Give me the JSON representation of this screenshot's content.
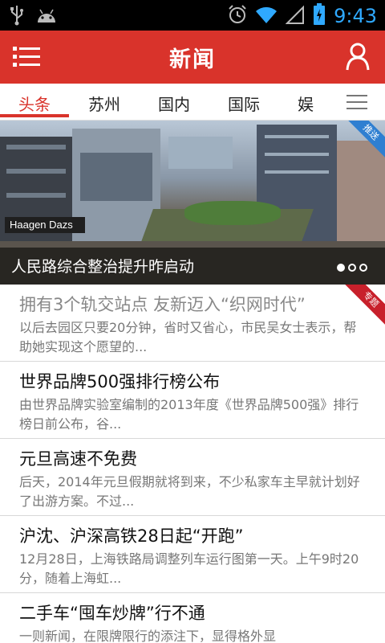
{
  "status_bar": {
    "time": "9:43",
    "icons": [
      "usb-icon",
      "android-icon",
      "alarm-icon",
      "wifi-icon",
      "signal-icon",
      "battery-icon"
    ]
  },
  "header": {
    "title": "新闻",
    "menu_icon": "menu-icon",
    "user_icon": "user-icon",
    "color": "#d9332b"
  },
  "tabs": [
    {
      "label": "头条",
      "active": true
    },
    {
      "label": "苏州"
    },
    {
      "label": "国内"
    },
    {
      "label": "国际"
    },
    {
      "label": "娱"
    }
  ],
  "banner": {
    "caption": "人民路综合整治提升昨启动",
    "tag": "推送",
    "sign_text": "Haagen Dazs"
  },
  "news": [
    {
      "title": "拥有3个轨交站点 友新迈入“织网时代”",
      "desc": "以后去园区只要20分钟，省时又省心，市民吴女士表示，帮助她实现这个愿望的...",
      "tag": "专题",
      "read": true
    },
    {
      "title": "世界品牌500强排行榜公布",
      "desc": "由世界品牌实验室编制的2013年度《世界品牌500强》排行榜日前公布，谷..."
    },
    {
      "title": "元旦高速不免费",
      "desc": "后天，2014年元旦假期就将到来，不少私家车主早就计划好了出游方案。不过..."
    },
    {
      "title": "沪沈、沪深高铁28日起“开跑”",
      "desc": "12月28日，上海铁路局调整列车运行图第一天。上午9时20分，随着上海虹..."
    },
    {
      "title": "二手车“囤车炒牌”行不通",
      "desc": "一则新闻，在限牌限行的添注下，显得格外显"
    }
  ]
}
